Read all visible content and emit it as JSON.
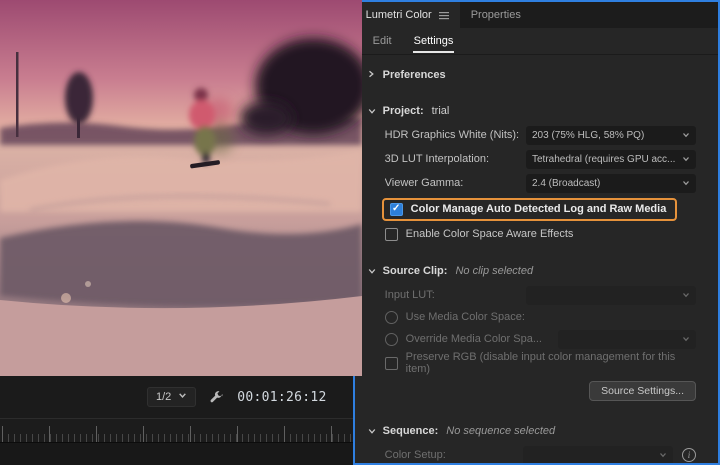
{
  "monitor": {
    "zoom_level": "1/2",
    "timecode": "00:01:26:12"
  },
  "panel": {
    "tabs": {
      "lumetri": "Lumetri Color",
      "properties": "Properties"
    },
    "subtabs": {
      "edit": "Edit",
      "settings": "Settings"
    },
    "preferences_label": "Preferences",
    "project": {
      "label": "Project:",
      "name": "trial",
      "rows": [
        {
          "label": "HDR Graphics White (Nits):",
          "value": "203 (75% HLG, 58% PQ)"
        },
        {
          "label": "3D LUT Interpolation:",
          "value": "Tetrahedral (requires GPU acc..."
        },
        {
          "label": "Viewer Gamma:",
          "value": "2.4 (Broadcast)"
        }
      ],
      "color_manage_label": "Color Manage Auto Detected Log and Raw Media",
      "aware_effects_label": "Enable Color Space Aware Effects"
    },
    "source_clip": {
      "label": "Source Clip:",
      "status": "No clip selected",
      "input_lut_label": "Input LUT:",
      "use_media_label": "Use Media Color Space:",
      "override_label": "Override Media Color Spa...",
      "preserve_rgb_label": "Preserve RGB (disable input color management for this item)",
      "source_settings_button": "Source Settings..."
    },
    "sequence": {
      "label": "Sequence:",
      "status": "No sequence selected",
      "color_setup_label": "Color Setup:"
    }
  },
  "colors": {
    "focus_border": "#2f7fe0",
    "highlight_orange": "#e6923b",
    "checkbox_checked": "#2d7fd9"
  }
}
